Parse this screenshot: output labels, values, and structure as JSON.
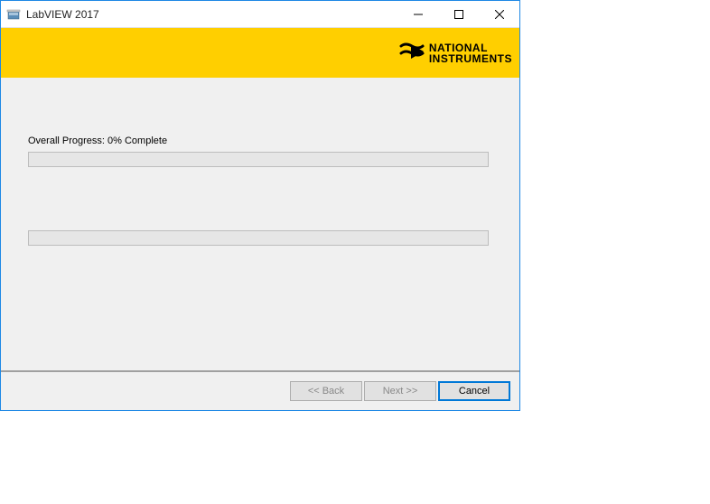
{
  "window": {
    "title": "LabVIEW 2017"
  },
  "banner": {
    "logo_line1": "NATIONAL",
    "logo_line2": "INSTRUMENTS"
  },
  "content": {
    "progress_label": "Overall Progress: 0% Complete"
  },
  "buttons": {
    "back": "<< Back",
    "next": "Next >>",
    "cancel": "Cancel"
  }
}
